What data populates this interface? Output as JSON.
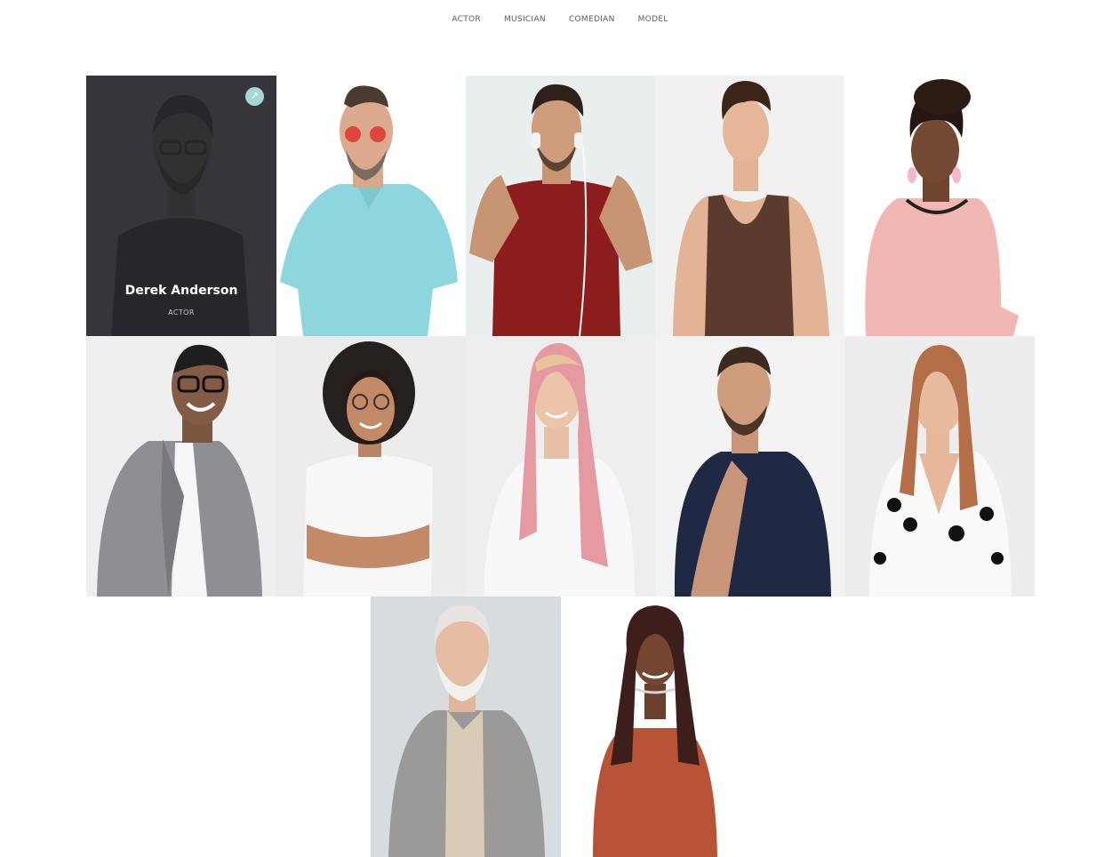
{
  "filters": [
    "ACTOR",
    "MUSICIAN",
    "COMEDIAN",
    "MODEL"
  ],
  "colors": {
    "overlay": "#2b2b2f",
    "link_icon_bg": "#a9d5d2"
  },
  "hovered_card": {
    "name": "Derek Anderson",
    "role": "ACTOR",
    "icon": "arrow-up-right-icon"
  },
  "portraits": [
    "derek-anderson",
    "man-red-sunglasses-teal-shirt",
    "man-headphones-red-tee",
    "woman-brown-tank-top",
    "woman-pink-sweater",
    "man-gray-blazer-glasses",
    "woman-curly-hair-white-tee",
    "woman-pink-hair",
    "man-navy-henley-tattoo",
    "woman-polka-dot-blouse",
    "older-man-gray-blazer",
    "woman-braids-orange-top"
  ]
}
